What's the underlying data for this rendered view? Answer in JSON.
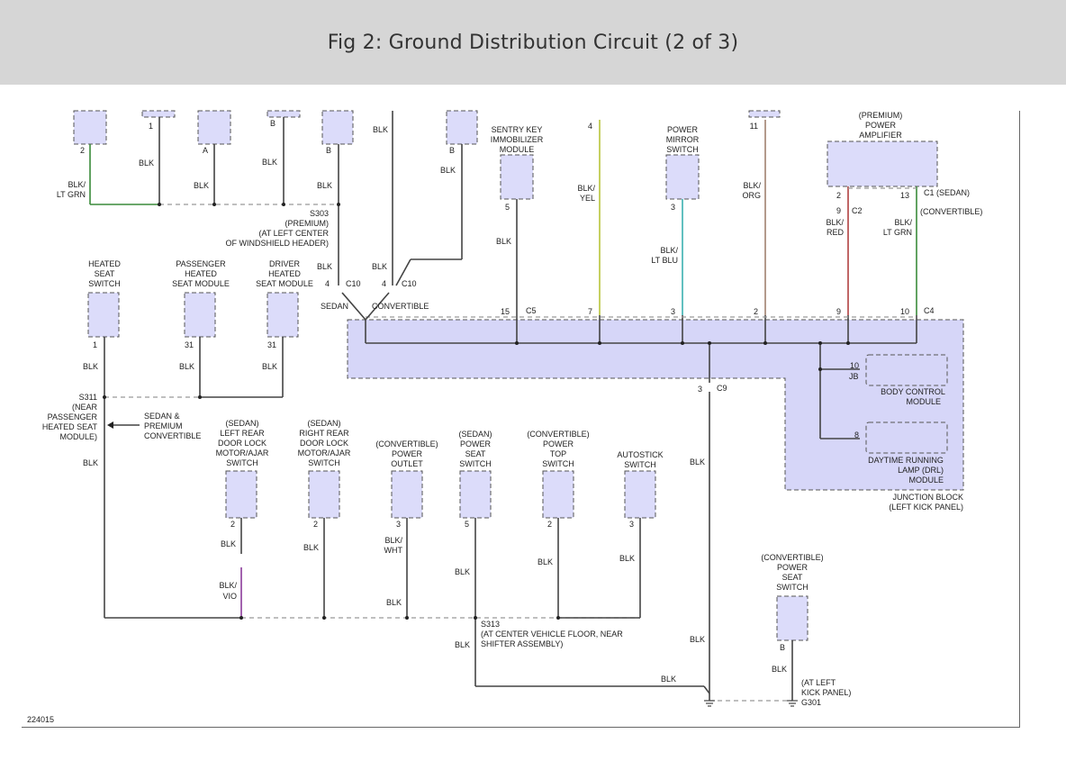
{
  "title": "Fig 2: Ground Distribution Circuit (2 of 3)",
  "figure_id": "224015",
  "colors": {
    "header_bg": "#d6d6d6",
    "component_fill": "#dcdcfa",
    "junction_block_fill": "#d6d6f8",
    "wire_black": "#444444",
    "wire_green": "#3a8a3a",
    "wire_yellow": "#b8c43a",
    "wire_light_blue": "#3ab0b0",
    "wire_orange": "#a08070",
    "wire_red": "#b04040",
    "wire_violet": "#8a3a9a"
  },
  "components": {
    "sentry_key": "SENTRY KEY IMMOBILIZER MODULE",
    "power_mirror": "POWER MIRROR SWITCH",
    "premium_amp": "(PREMIUM) POWER AMPLIFIER",
    "heated_seat_switch": "HEATED SEAT SWITCH",
    "pass_heated_module": "PASSENGER HEATED SEAT MODULE",
    "driver_heated_module": "DRIVER HEATED SEAT MODULE",
    "lr_door_lock": "(SEDAN) LEFT REAR DOOR LOCK MOTOR/AJAR SWITCH",
    "rr_door_lock": "(SEDAN) RIGHT REAR DOOR LOCK MOTOR/AJAR SWITCH",
    "power_outlet": "(CONVERTIBLE) POWER OUTLET",
    "power_seat_switch": "(SEDAN) POWER SEAT SWITCH",
    "power_top_switch": "(CONVERTIBLE) POWER TOP SWITCH",
    "autostick_switch": "AUTOSTICK SWITCH",
    "conv_power_seat_switch": "(CONVERTIBLE) POWER SEAT SWITCH",
    "body_control_module": "BODY CONTROL MODULE",
    "drl_module": "DAYTIME RUNNING LAMP (DRL) MODULE",
    "junction_block": "JUNCTION BLOCK (LEFT KICK PANEL)"
  },
  "splices": {
    "s303": "S303 (PREMIUM) (AT LEFT CENTER OF WINDSHIELD HEADER)",
    "s311": "S311 (NEAR PASSENGER HEATED SEAT MODULE)",
    "s313": "S313 (AT CENTER VEHICLE FLOOR, NEAR SHIFTER ASSEMBLY)",
    "g301": "(AT LEFT KICK PANEL) G301"
  },
  "notes": {
    "sedan": "SEDAN",
    "convertible": "CONVERTIBLE",
    "sedan_premium_convertible": "SEDAN & PREMIUM CONVERTIBLE",
    "c1_sedan": "C1 (SEDAN)",
    "convertible_paren": "(CONVERTIBLE)"
  },
  "wire_colors": [
    "BLK",
    "BLK/ LT GRN",
    "BLK/ YEL",
    "BLK/ LT BLU",
    "BLK/ ORG",
    "BLK/ RED",
    "BLK/ VIO",
    "BLK/ WHT"
  ],
  "connectors": [
    "C1",
    "C2",
    "C4",
    "C5",
    "C9",
    "C10",
    "JB"
  ]
}
